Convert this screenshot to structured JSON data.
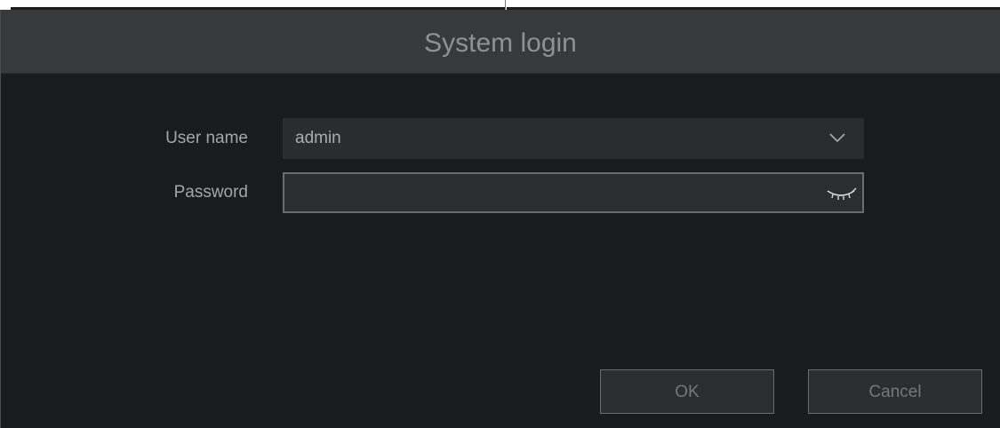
{
  "dialog": {
    "title": "System login"
  },
  "form": {
    "username_label": "User name",
    "username_value": "admin",
    "password_label": "Password",
    "password_value": ""
  },
  "buttons": {
    "ok_label": "OK",
    "cancel_label": "Cancel"
  },
  "icons": {
    "dropdown": "chevron-down-icon",
    "password_visibility": "eye-closed-icon"
  },
  "colors": {
    "background": "#191c1e",
    "titlebar": "#363a3d",
    "field": "#2a2d30",
    "border": "#6a6d70",
    "text": "#a3a6a9"
  }
}
